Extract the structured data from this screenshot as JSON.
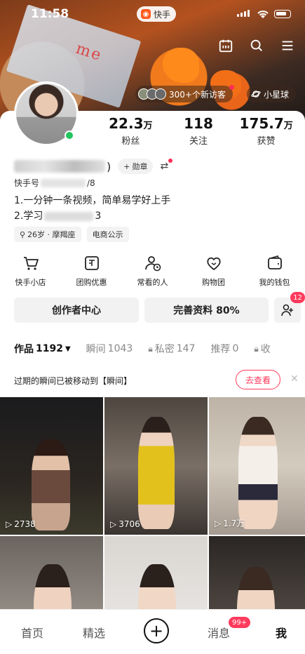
{
  "status_bar": {
    "time": "11:58",
    "app_badge": "快手"
  },
  "banner": {
    "paper_text": "me",
    "visitors": "300+个新访客",
    "planet": "小星球"
  },
  "profile": {
    "name_suffix": ")",
    "medal_label": "勋章",
    "ks_id_prefix": "快手号",
    "ks_id_suffix": "/8",
    "bio_line1": "1.一分钟一条视频，简单易学好上手",
    "bio_line2_prefix": "2.学习",
    "bio_line2_suffix": "3",
    "tags": [
      "26岁 · 摩羯座",
      "电商公示"
    ]
  },
  "stats": [
    {
      "num": "22.3",
      "unit": "万",
      "label": "粉丝"
    },
    {
      "num": "118",
      "unit": "",
      "label": "关注"
    },
    {
      "num": "175.7",
      "unit": "万",
      "label": "获赞"
    }
  ],
  "shortcuts": [
    {
      "label": "快手小店",
      "icon": "cart-icon"
    },
    {
      "label": "团购优惠",
      "icon": "coupon-icon"
    },
    {
      "label": "常看的人",
      "icon": "person-clock-icon"
    },
    {
      "label": "购物团",
      "icon": "heart-bag-icon"
    },
    {
      "label": "我的钱包",
      "icon": "wallet-icon"
    }
  ],
  "actions": {
    "creator_center": "创作者中心",
    "complete_profile": "完善资料 80%",
    "add_friend_badge": "12"
  },
  "tabs": [
    {
      "label": "作品",
      "count": "1192",
      "active": true
    },
    {
      "label": "瞬间",
      "count": "1043",
      "active": false
    },
    {
      "label": "私密",
      "count": "147",
      "active": false
    },
    {
      "label": "推荐",
      "count": "0",
      "active": false
    },
    {
      "label": "收",
      "count": "",
      "active": false
    }
  ],
  "notice": {
    "text": "过期的瞬间已被移动到【瞬间】",
    "action": "去查看"
  },
  "videos": [
    {
      "plays": "2738"
    },
    {
      "plays": "3706"
    },
    {
      "plays": "1.7万"
    },
    {
      "plays": ""
    },
    {
      "plays": ""
    },
    {
      "plays": ""
    }
  ],
  "nav": {
    "home": "首页",
    "featured": "精选",
    "messages": "消息",
    "messages_badge": "99+",
    "me": "我"
  },
  "colors": {
    "accent": "#ff3b5c",
    "online": "#22c55e"
  }
}
